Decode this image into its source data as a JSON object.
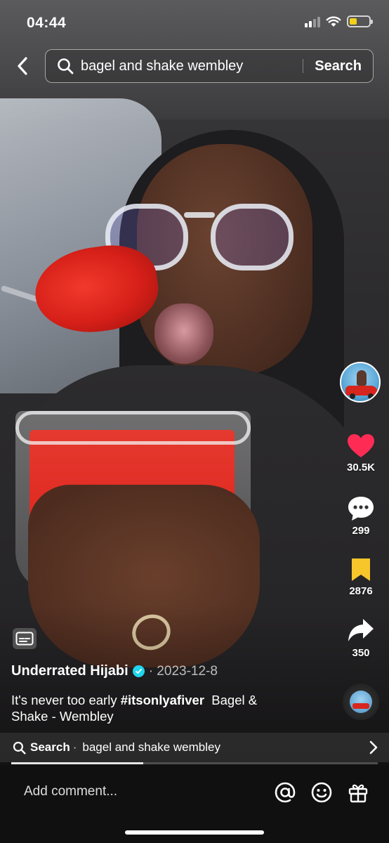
{
  "status_bar": {
    "time": "04:44",
    "battery_level": 0.4,
    "battery_color": "#f2d21b"
  },
  "search": {
    "query": "bagel and shake wembley",
    "button_label": "Search"
  },
  "actions": {
    "likes": "30.5K",
    "comments": "299",
    "saves": "2876",
    "shares": "350",
    "like_color": "#fe2c55",
    "save_color": "#f7c62a"
  },
  "post": {
    "author": "Underrated Hijabi",
    "date": "· 2023-12-8",
    "caption_text": "It's never too early ",
    "hashtag": "#itsonlyafiver",
    "caption_tail": "  Bagel & Shake - Wembley"
  },
  "suggestion": {
    "label": "Search",
    "separator": "·",
    "query": "bagel and shake wembley"
  },
  "progress": 0.36,
  "comment": {
    "placeholder": "Add comment..."
  },
  "icons": [
    "back-icon",
    "search-icon",
    "heart-icon",
    "comment-icon",
    "bookmark-icon",
    "share-icon",
    "captions-icon",
    "verified-icon",
    "chevron-right-icon",
    "at-icon",
    "emoji-icon",
    "gift-icon"
  ]
}
